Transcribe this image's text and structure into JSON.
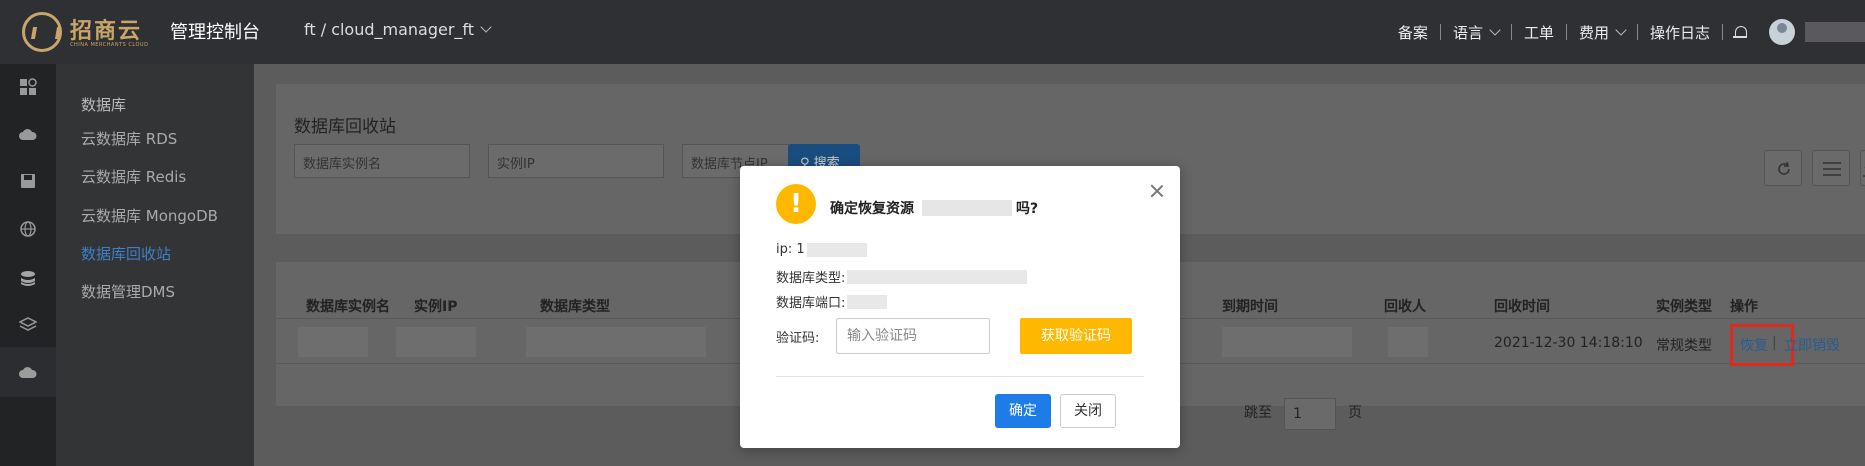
{
  "header": {
    "logo_text": "招商云",
    "logo_sub": "CHINA MERCHANTS CLOUD",
    "console_title": "管理控制台",
    "project": "ft / cloud_manager_ft",
    "nav": [
      "备案",
      "语言",
      "工单",
      "费用",
      "操作日志"
    ]
  },
  "sidebar": {
    "title": "数据库",
    "items": [
      "云数据库 RDS",
      "云数据库 Redis",
      "云数据库 MongoDB",
      "数据库回收站",
      "数据管理DMS"
    ],
    "active_index": 3
  },
  "main": {
    "page_title": "数据库回收站",
    "filters": {
      "instance_name_placeholder": "数据库实例名",
      "ip_placeholder": "实例IP",
      "node_ip_placeholder": "数据库节点IP"
    },
    "search_label": "搜索",
    "table": {
      "headers": [
        "数据库实例名",
        "实例IP",
        "数据库类型",
        "到期时间",
        "回收人",
        "回收时间",
        "实例类型",
        "操作"
      ],
      "row": {
        "recycle_time": "2021-12-30 14:18:10",
        "instance_type": "常规类型",
        "restore": "恢复",
        "destroy": "立即销毁"
      }
    },
    "pager": {
      "jump_label": "跳至",
      "page_value": "1",
      "page_unit": "页"
    }
  },
  "modal": {
    "title_prefix": "确定恢复资源",
    "title_suffix": "吗?",
    "ip_label": "ip: 1",
    "type_label": "数据库类型:",
    "port_label": "数据库端口:",
    "code_label": "验证码:",
    "code_placeholder": "输入验证码",
    "get_code": "获取验证码",
    "ok": "确定",
    "close": "关闭"
  },
  "colors": {
    "topbar": "#2f3033",
    "accent": "#1e7ce8",
    "warning": "#ffb800",
    "highlight": "#e12a1e"
  }
}
